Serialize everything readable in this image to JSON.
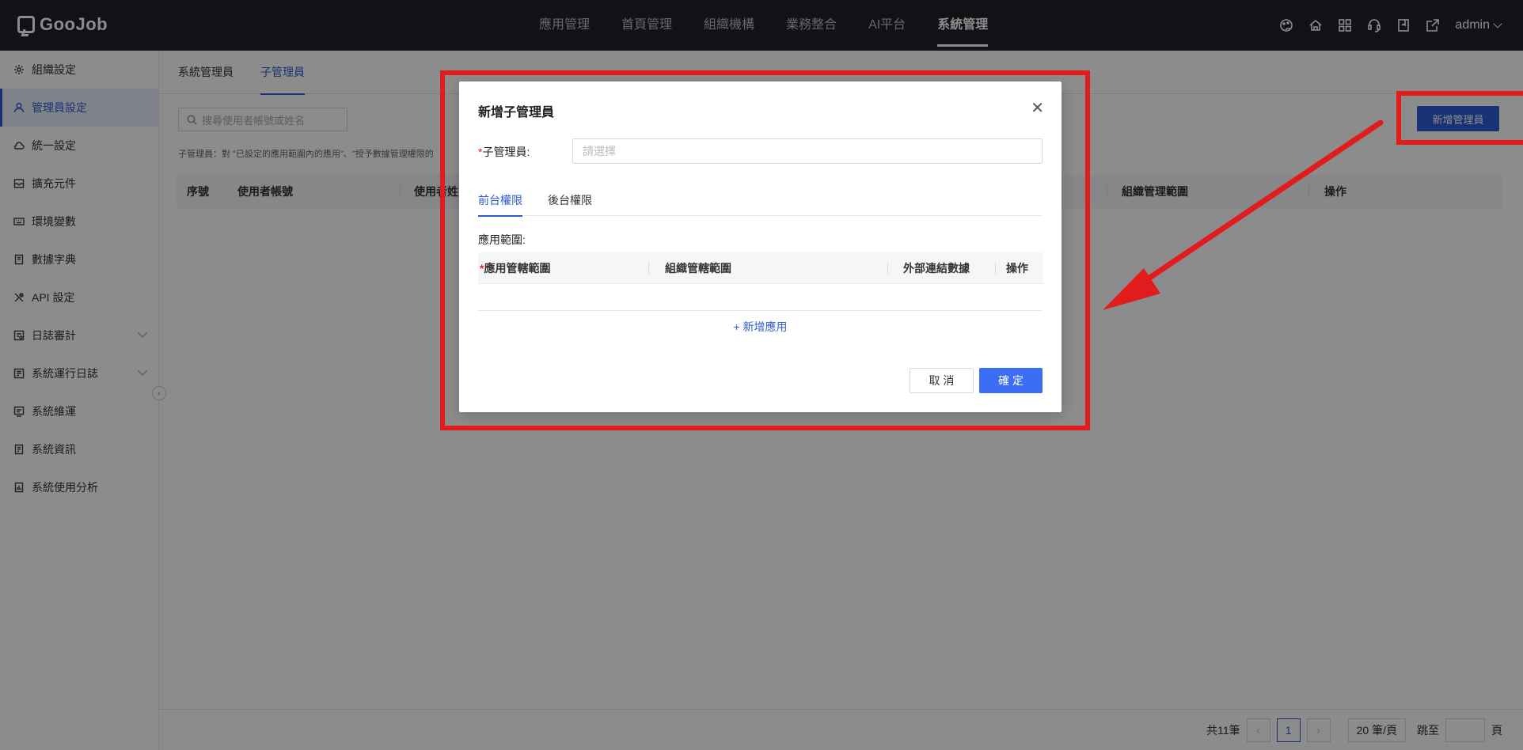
{
  "app": {
    "logo_text": "GooJob"
  },
  "topnav": {
    "items": [
      {
        "label": "應用管理"
      },
      {
        "label": "首頁管理"
      },
      {
        "label": "組織機構"
      },
      {
        "label": "業務整合"
      },
      {
        "label": "AI平台"
      },
      {
        "label": "系統管理",
        "active": true
      }
    ],
    "icons": [
      "palette-icon",
      "home-icon",
      "apps-grid-icon",
      "headset-icon",
      "book-icon",
      "export-icon"
    ],
    "user": "admin"
  },
  "sidebar": {
    "items": [
      {
        "label": "組織設定",
        "icon": "gear-icon"
      },
      {
        "label": "管理員設定",
        "icon": "user-icon",
        "active": true
      },
      {
        "label": "統一設定",
        "icon": "cloud-icon"
      },
      {
        "label": "擴充元件",
        "icon": "inbox-icon"
      },
      {
        "label": "環境變數",
        "icon": "keyboard-icon"
      },
      {
        "label": "數據字典",
        "icon": "book-icon"
      },
      {
        "label": "API 設定",
        "icon": "tools-icon"
      },
      {
        "label": "日誌審計",
        "icon": "audit-icon",
        "expandable": true
      },
      {
        "label": "系統運行日誌",
        "icon": "log-icon",
        "expandable": true
      },
      {
        "label": "系統維運",
        "icon": "maintain-icon"
      },
      {
        "label": "系統資訊",
        "icon": "info-doc-icon"
      },
      {
        "label": "系統使用分析",
        "icon": "analysis-icon"
      }
    ]
  },
  "main": {
    "tabs": [
      {
        "label": "系統管理員"
      },
      {
        "label": "子管理員",
        "active": true
      }
    ],
    "search_placeholder": "搜尋使用者帳號或姓名",
    "hint": "子管理員：對 \"已設定的應用範圍內的應用\"、\"授予數據管理權限的",
    "add_button": "新增管理員",
    "table_headers": [
      "序號",
      "使用者帳號",
      "使用者姓",
      "組織管理範圍",
      "操作"
    ],
    "pagination": {
      "total": "共11筆",
      "current_page": "1",
      "page_size": "20 筆/頁",
      "jump_label": "跳至",
      "page_suffix": "頁"
    }
  },
  "modal": {
    "title": "新增子管理員",
    "field_label": "子管理員:",
    "field_placeholder": "請選擇",
    "tabs": [
      {
        "label": "前台權限",
        "active": true
      },
      {
        "label": "後台權限"
      }
    ],
    "scope_label": "應用範圍:",
    "table_headers": [
      "應用管轄範圍",
      "組織管轄範圍",
      "外部連結數據",
      "操作"
    ],
    "add_app_link": "+ 新增應用",
    "cancel_label": "取 消",
    "ok_label": "確 定"
  },
  "colors": {
    "topbar_bg": "#1e2128",
    "primary": "#2f5bd3",
    "confirm_button": "#3b6ef5",
    "annotation_red": "#e21c1c"
  }
}
